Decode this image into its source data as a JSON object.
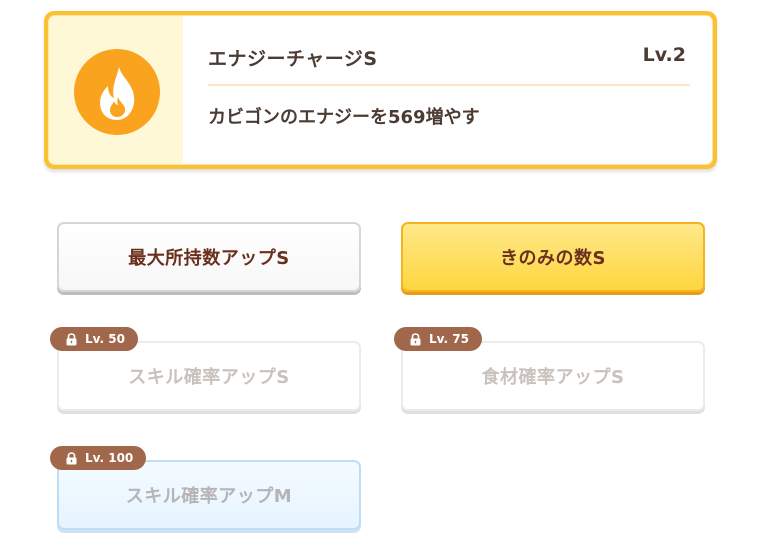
{
  "skill": {
    "name": "エナジーチャージS",
    "level": "Lv.2",
    "description": "カビゴンのエナジーを569増やす",
    "icon": "flame-icon"
  },
  "options": [
    {
      "label": "最大所持数アップS",
      "state": "available"
    },
    {
      "label": "きのみの数S",
      "state": "selected"
    },
    {
      "label": "スキル確率アップS",
      "state": "locked",
      "lock_label": "Lv. 50"
    },
    {
      "label": "食材確率アップS",
      "state": "locked",
      "lock_label": "Lv. 75"
    },
    {
      "label": "スキル確率アップM",
      "state": "locked",
      "lock_label": "Lv. 100"
    }
  ],
  "colors": {
    "accent_orange": "#f9a31f",
    "card_border": "#fbc132",
    "tag_brown": "#a1674a",
    "text_dark": "#4b3b33"
  }
}
